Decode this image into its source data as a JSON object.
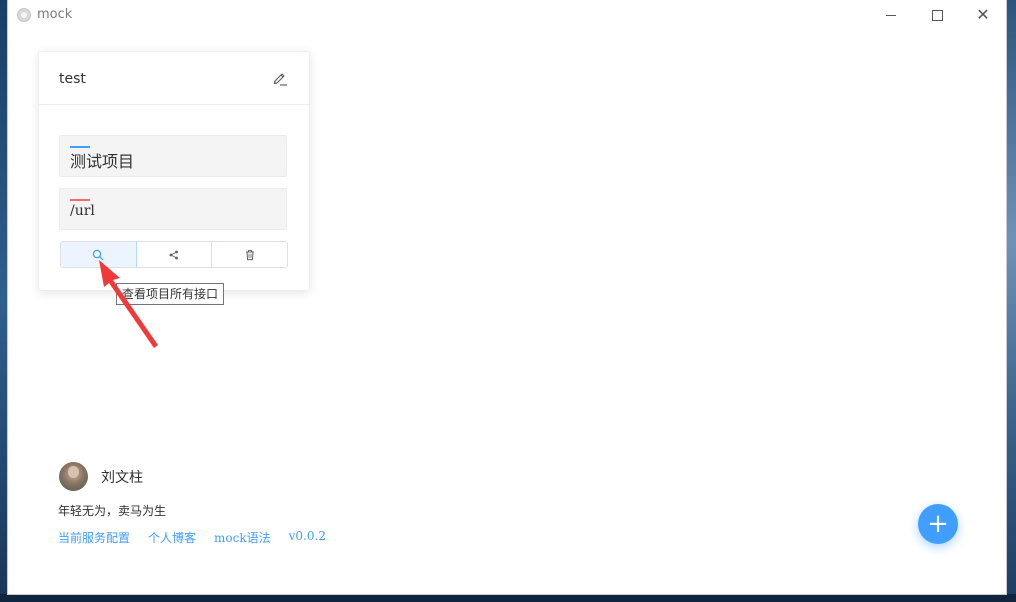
{
  "window": {
    "title": "mock"
  },
  "project_card": {
    "title": "test",
    "name_value": "测试项目",
    "url_value": "/url",
    "actions": [
      {
        "icon": "search-icon",
        "label": "查看项目所有接口"
      },
      {
        "icon": "share-icon"
      },
      {
        "icon": "trash-icon"
      }
    ],
    "tooltip": "查看项目所有接口"
  },
  "profile": {
    "name": "刘文柱",
    "motto": "年轻无为，卖马为生",
    "links": [
      "当前服务配置",
      "个人博客",
      "mock语法",
      "v0.0.2"
    ]
  },
  "fab": {
    "label": "+"
  },
  "colors": {
    "accent": "#409eff",
    "danger": "#f56c6c",
    "annotation_arrow": "#f03a3a"
  }
}
